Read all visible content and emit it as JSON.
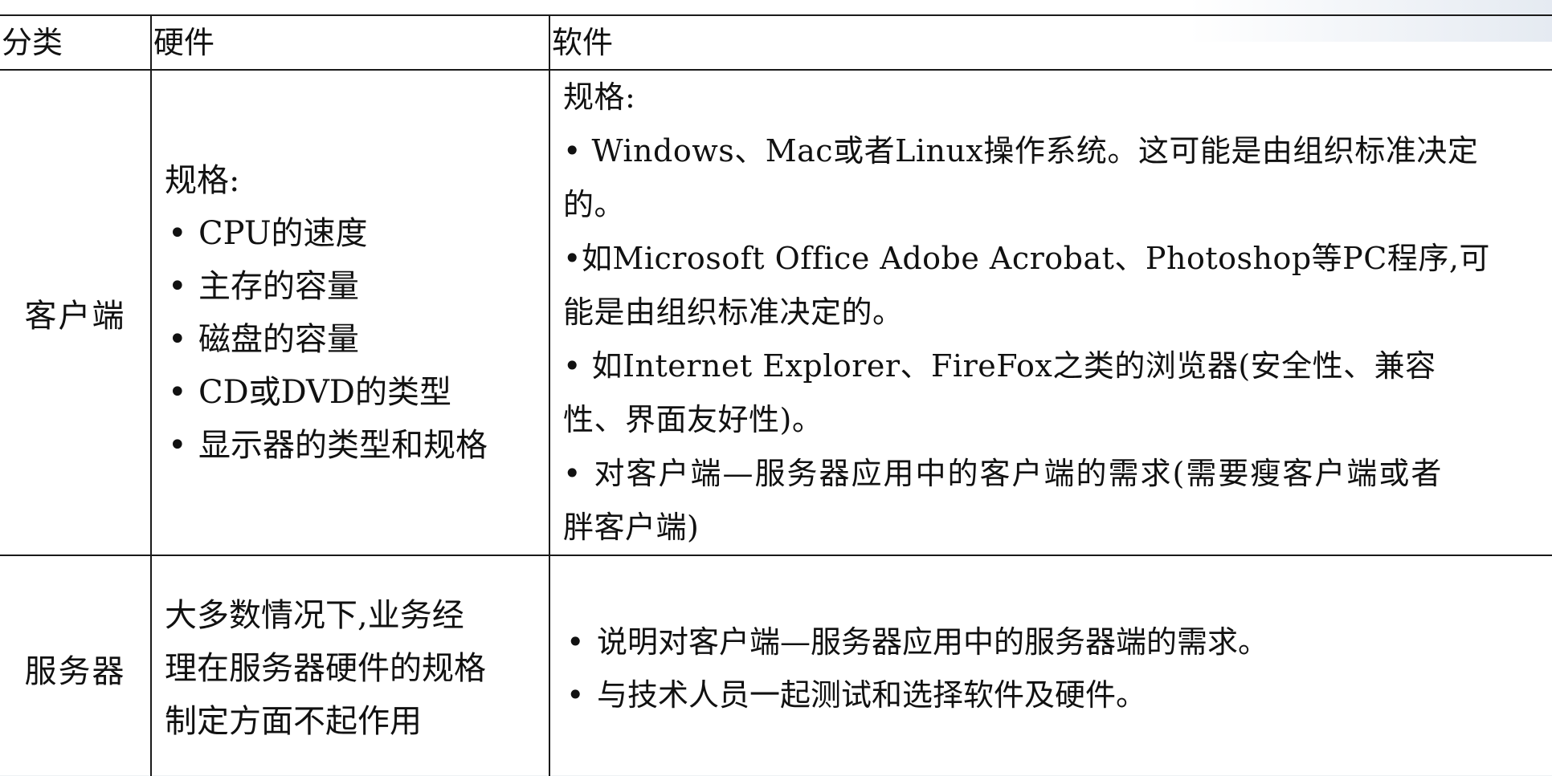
{
  "header": {
    "category": "分类",
    "hardware": "硬件",
    "software": "软件"
  },
  "client": {
    "category": "客户端",
    "hardware": {
      "title": "规格:",
      "items": [
        "CPU的速度",
        "主存的容量",
        "磁盘的容量",
        "CD或DVD的类型",
        "显示器的类型和规格"
      ]
    },
    "software": {
      "title": "规格:",
      "items": [
        {
          "line1": "• Windows、Mac或者Linux操作系统。这可能是由组织标准决定",
          "line2": "的。"
        },
        {
          "line1": "•如Microsoft Office Adobe Acrobat、Photoshop等PC程序,可",
          "line2": "能是由组织标准决定的。"
        },
        {
          "line1": "• 如Internet Explorer、FireFox之类的浏览器(安全性、兼容",
          "line2": "性、界面友好性)。"
        },
        {
          "line1": "• 对客户端—服务器应用中的客户端的需求(需要瘦客户端或者",
          "line2": "胖客户端)"
        }
      ]
    }
  },
  "server": {
    "category": "服务器",
    "hardware": {
      "lines": [
        "大多数情况下,业务经",
        "理在服务器硬件的规格",
        "制定方面不起作用"
      ]
    },
    "software": {
      "items": [
        "说明对客户端—服务器应用中的服务器端的需求。",
        "与技术人员一起测试和选择软件及硬件。"
      ]
    }
  }
}
